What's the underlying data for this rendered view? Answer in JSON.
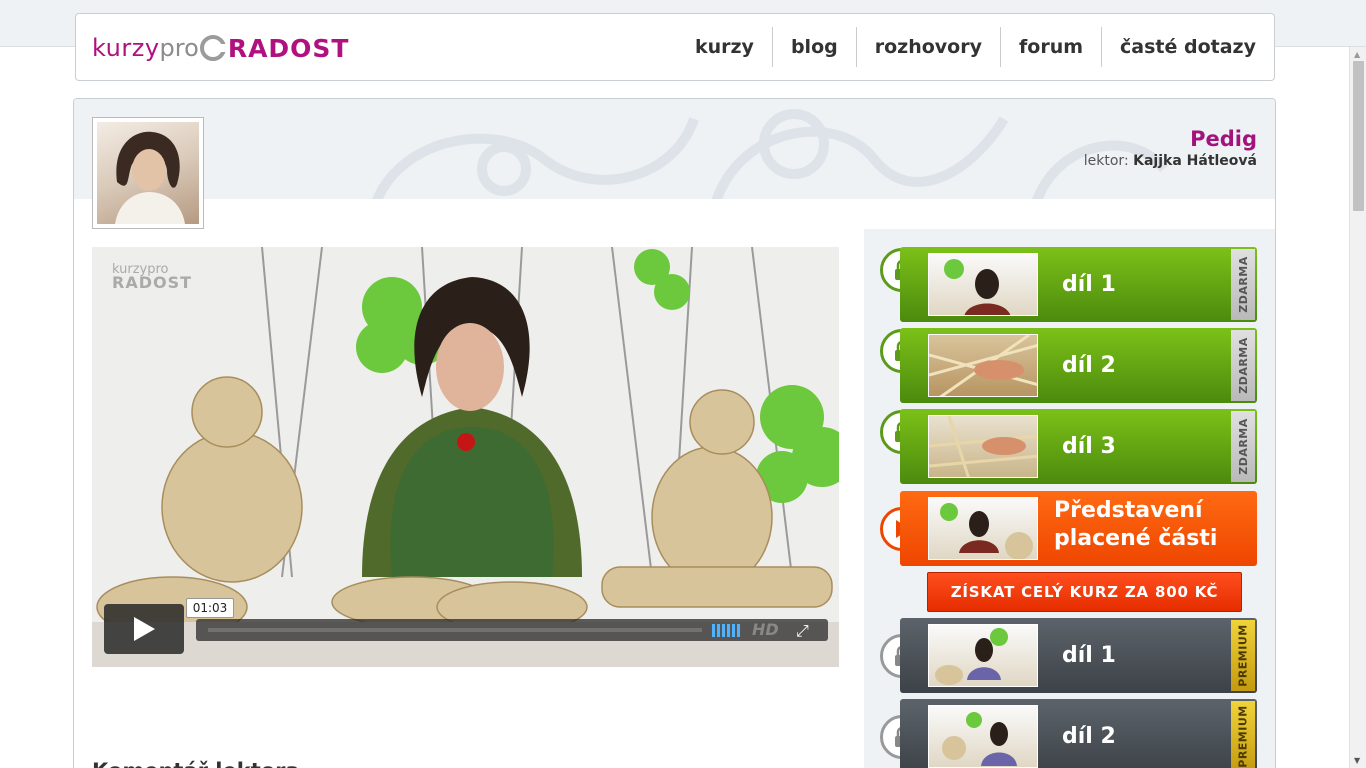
{
  "header": {
    "logo": {
      "part1": "kurzy",
      "part2": "pro",
      "part3": "RADOST"
    },
    "nav": [
      "kurzy",
      "blog",
      "rozhovory",
      "forum",
      "časté dotazy"
    ]
  },
  "course": {
    "title": "Pedig",
    "lector_label": "lektor:",
    "lector_name": "Kajjka Hátleová"
  },
  "video": {
    "watermark_small": "kurzypro",
    "watermark_big": "RADOST",
    "time": "01:03",
    "hd_label": "HD"
  },
  "lessons_free": [
    {
      "label": "díl 1",
      "badge": "ZDARMA"
    },
    {
      "label": "díl 2",
      "badge": "ZDARMA"
    },
    {
      "label": "díl 3",
      "badge": "ZDARMA"
    }
  ],
  "preview": {
    "line1": "Představení",
    "line2": "placené části"
  },
  "buy_button": "ZÍSKAT CELÝ KURZ ZA 800 KČ",
  "lessons_premium": [
    {
      "label": "díl 1",
      "badge": "PREMIUM"
    },
    {
      "label": "díl 2",
      "badge": "PREMIUM"
    }
  ],
  "comment_heading": "Komentář lektora",
  "colors": {
    "brand": "#b0117f",
    "free_lesson": "#62a314",
    "preview": "#ff5a0a",
    "premium_lesson": "#4a5157",
    "premium_badge": "#e0b824"
  },
  "icons": [
    "unlock-icon",
    "lock-icon",
    "play-circle-icon",
    "play-icon",
    "fullscreen-icon",
    "volume-icon"
  ]
}
